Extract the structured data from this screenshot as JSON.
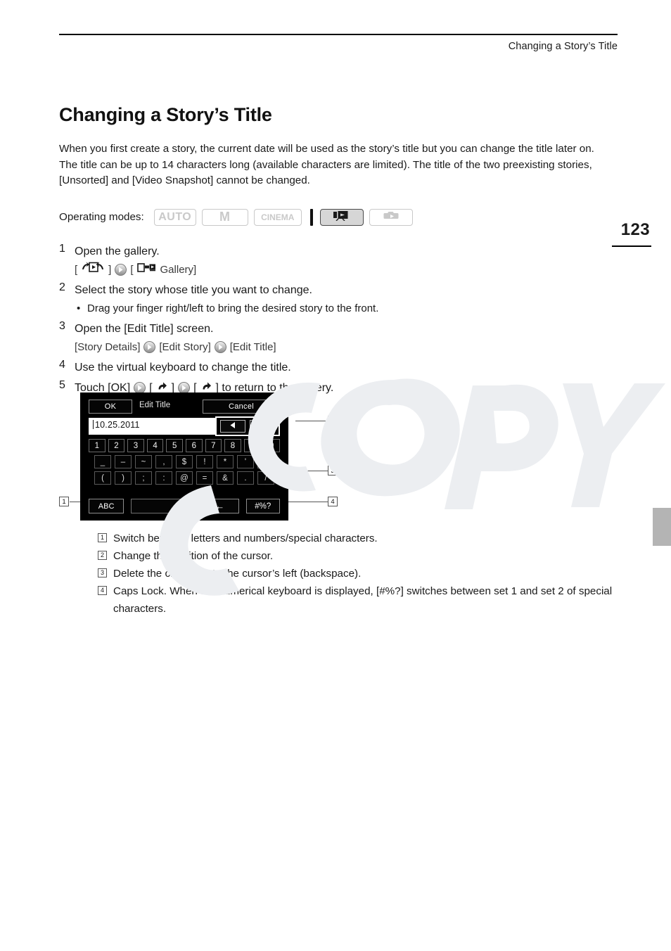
{
  "header": {
    "running_title": "Changing a Story’s Title"
  },
  "page": {
    "number": "123"
  },
  "doc": {
    "title": "Changing a Story’s Title",
    "intro": "When you first create a story, the current date will be used as the story’s title but you can change the title later on. The title can be up to 14 characters long (available characters are limited). The title of the two preexisting stories, [Unsorted] and [Video Snapshot] cannot be changed."
  },
  "operating_modes": {
    "label": "Operating modes:",
    "chips": [
      {
        "name": "auto",
        "text": "AUTO",
        "active": false
      },
      {
        "name": "manual",
        "text": "M",
        "active": false
      },
      {
        "name": "cinema",
        "text": "CINEMA",
        "active": false
      },
      {
        "name": "movie-playback",
        "text": "",
        "active": true
      },
      {
        "name": "photo-playback",
        "text": "",
        "active": false
      }
    ]
  },
  "steps": [
    {
      "num": "1",
      "head": "Open the gallery.",
      "sub_pre": "[",
      "sub_mid": "]",
      "sub_post_open": "[",
      "sub_post_label": "Gallery]"
    },
    {
      "num": "2",
      "head": "Select the story whose title you want to change.",
      "bullet": "Drag your finger right/left to bring the desired story to the front."
    },
    {
      "num": "3",
      "head": "Open the [Edit Title] screen.",
      "path_1": "[Story Details]",
      "path_2": "[Edit Story]",
      "path_3": "[Edit Title]"
    },
    {
      "num": "4",
      "head": "Use the virtual keyboard to change the title."
    },
    {
      "num": "5",
      "head_1": "Touch [OK]",
      "head_2": "[",
      "head_3": "]",
      "head_4": "[",
      "head_5": "] to return to the gallery."
    }
  ],
  "keyboard_screen": {
    "ok_label": "OK",
    "title": "Edit Title",
    "cancel_label": "Cancel",
    "field_value": "10.25.2011",
    "cursor_left_icon": "left-triangle-icon",
    "cursor_right_icon": "right-triangle-icon",
    "number_row": [
      "1",
      "2",
      "3",
      "4",
      "5",
      "6",
      "7",
      "8",
      "9",
      "0"
    ],
    "symbol_row_1": [
      "_",
      "–",
      "~",
      ",",
      "$",
      "!",
      "*",
      "'",
      "+"
    ],
    "symbol_row_2": [
      "(",
      ")",
      ";",
      ":",
      "@",
      "=",
      "&",
      ".",
      "/"
    ],
    "abc_label": "ABC",
    "space_label": "",
    "backspace_label": "←",
    "symbol_toggle_label": "#%?"
  },
  "callouts": [
    {
      "id": "1"
    },
    {
      "id": "2"
    },
    {
      "id": "3"
    },
    {
      "id": "4"
    }
  ],
  "legend": [
    {
      "id": "1",
      "text": "Switch between letters and numbers/special characters."
    },
    {
      "id": "2",
      "text": "Change the position of the cursor."
    },
    {
      "id": "3",
      "text": "Delete the character to the cursor’s left (backspace)."
    },
    {
      "id": "4",
      "text": "Caps Lock. When the numerical keyboard is displayed, [#%?] switches between set 1 and set 2 of special characters."
    }
  ],
  "colors": {
    "ink": "#1a1a1a",
    "rule": "#000000",
    "chip_inactive": "#c9c9c9",
    "chip_active_bg": "#d6d6d6",
    "edge_tab": "#b4b4b4",
    "screen_bg": "#000000",
    "watermark": "#eceef1"
  }
}
